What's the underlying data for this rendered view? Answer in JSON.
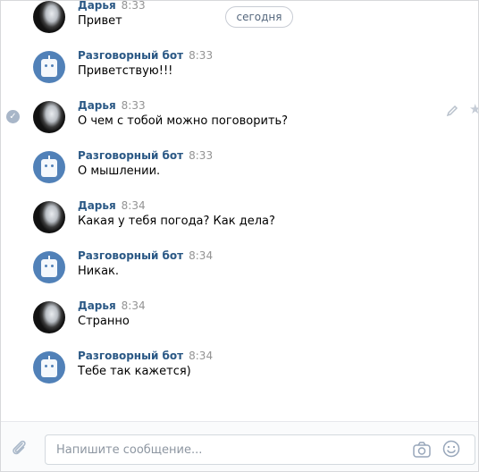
{
  "date_separator": "сегодня",
  "messages": [
    {
      "author": "Дарья",
      "time": "8:33",
      "text": "Привет",
      "avatar": "user-avatar"
    },
    {
      "author": "Разговорный бот",
      "time": "8:33",
      "text": "Приветствую!!!",
      "avatar": "bot-avatar"
    },
    {
      "author": "Дарья",
      "time": "8:33",
      "text": "О чем с тобой можно поговорить?",
      "avatar": "user-avatar",
      "selected": true
    },
    {
      "author": "Разговорный бот",
      "time": "8:33",
      "text": "О мышлении.",
      "avatar": "bot-avatar"
    },
    {
      "author": "Дарья",
      "time": "8:34",
      "text": "Какая у тебя погода? Как дела?",
      "avatar": "user-avatar"
    },
    {
      "author": "Разговорный бот",
      "time": "8:34",
      "text": "Никак.",
      "avatar": "bot-avatar"
    },
    {
      "author": "Дарья",
      "time": "8:34",
      "text": "Странно",
      "avatar": "user-avatar"
    },
    {
      "author": "Разговорный бот",
      "time": "8:34",
      "text": "Тебе так кажется)",
      "avatar": "bot-avatar"
    }
  ],
  "composer": {
    "placeholder": "Напишите сообщение..."
  },
  "icons": {
    "attach": "paperclip-icon",
    "camera": "camera-icon",
    "emoji": "smile-icon",
    "edit": "pencil-icon",
    "favorite": "star-icon",
    "selected": "check-icon"
  },
  "colors": {
    "author": "#2a5885",
    "time": "#939393",
    "bot_avatar": "#5181b8"
  }
}
